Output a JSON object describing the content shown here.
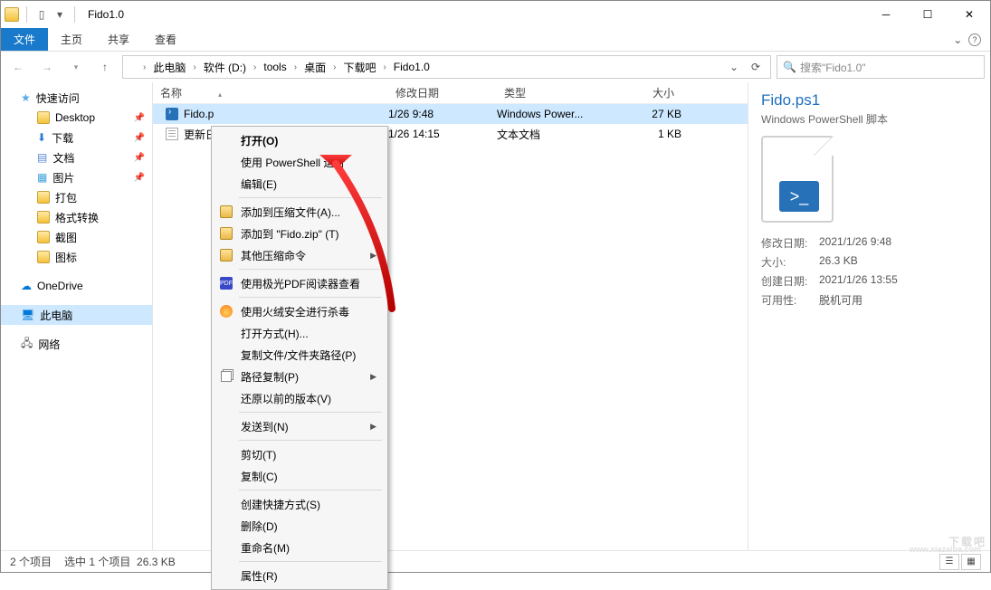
{
  "window": {
    "title": "Fido1.0"
  },
  "ribbon": {
    "file": "文件",
    "tabs": [
      "主页",
      "共享",
      "查看"
    ]
  },
  "breadcrumbs": [
    "此电脑",
    "软件 (D:)",
    "tools",
    "桌面",
    "下载吧",
    "Fido1.0"
  ],
  "search": {
    "placeholder": "搜索\"Fido1.0\""
  },
  "nav": {
    "quick": {
      "label": "快速访问",
      "items": [
        "Desktop",
        "下载",
        "文档",
        "图片",
        "打包",
        "格式转换",
        "截图",
        "图标"
      ]
    },
    "onedrive": "OneDrive",
    "thispc": "此电脑",
    "network": "网络"
  },
  "columns": {
    "name": "名称",
    "date": "修改日期",
    "type": "类型",
    "size": "大小"
  },
  "files": [
    {
      "name": "Fido.ps1",
      "short": "Fido.p",
      "date": "1/26 9:48",
      "type": "Windows Power...",
      "size": "27 KB",
      "icon": "ps1",
      "selected": true
    },
    {
      "name": "更新日",
      "short": "更新日",
      "date": "1/26 14:15",
      "type": "文本文档",
      "size": "1 KB",
      "icon": "txt",
      "selected": false
    }
  ],
  "context": [
    {
      "label": "打开(O)",
      "bold": true
    },
    {
      "label": "使用 PowerShell 运行"
    },
    {
      "label": "编辑(E)"
    },
    {
      "sep": true
    },
    {
      "label": "添加到压缩文件(A)...",
      "icon": "zip"
    },
    {
      "label": "添加到 \"Fido.zip\" (T)",
      "icon": "zip"
    },
    {
      "label": "其他压缩命令",
      "icon": "zip",
      "sub": true
    },
    {
      "sep": true
    },
    {
      "label": "使用极光PDF阅读器查看",
      "icon": "pdf"
    },
    {
      "sep": true
    },
    {
      "label": "使用火绒安全进行杀毒",
      "icon": "fire"
    },
    {
      "label": "打开方式(H)..."
    },
    {
      "label": "复制文件/文件夹路径(P)"
    },
    {
      "label": "路径复制(P)",
      "icon": "copy",
      "sub": true
    },
    {
      "label": "还原以前的版本(V)"
    },
    {
      "sep": true
    },
    {
      "label": "发送到(N)",
      "sub": true
    },
    {
      "sep": true
    },
    {
      "label": "剪切(T)"
    },
    {
      "label": "复制(C)"
    },
    {
      "sep": true
    },
    {
      "label": "创建快捷方式(S)"
    },
    {
      "label": "删除(D)"
    },
    {
      "label": "重命名(M)"
    },
    {
      "sep": true
    },
    {
      "label": "属性(R)"
    }
  ],
  "details": {
    "name": "Fido.ps1",
    "type": "Windows PowerShell 脚本",
    "meta": [
      {
        "k": "修改日期:",
        "v": "2021/1/26 9:48"
      },
      {
        "k": "大小:",
        "v": "26.3 KB"
      },
      {
        "k": "创建日期:",
        "v": "2021/1/26 13:55"
      },
      {
        "k": "可用性:",
        "v": "脱机可用"
      }
    ]
  },
  "status": {
    "items": "2 个项目",
    "sel": "选中 1 个项目",
    "size": "26.3 KB"
  },
  "watermark": {
    "big": "下载吧",
    "small": "www.xiazaiba.com"
  }
}
